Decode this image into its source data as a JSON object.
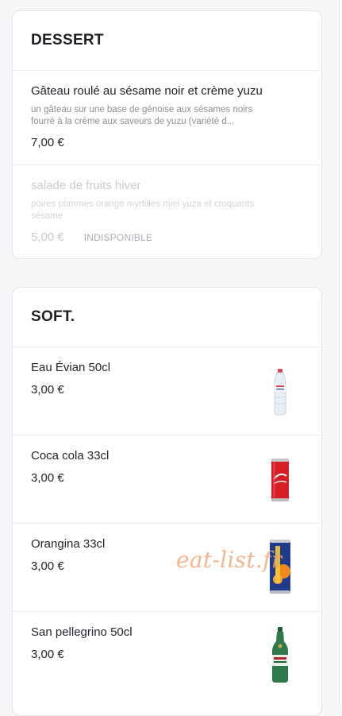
{
  "dessert": {
    "title": "DESSERT",
    "items": [
      {
        "name": "Gâteau roulé au sésame noir et crème yuzu",
        "description_line1": "un gâteau sur une base de génoise aux sésames noirs",
        "description_line2": "fourré à la crème aux saveurs de yuzu (variété d...",
        "price": "7,00 €",
        "available": true
      },
      {
        "name": "salade de fruits hiver",
        "description_line1": "poires pommes orange myrtilles miel yuza et croquants",
        "description_line2": "sésame",
        "price": "5,00 €",
        "badge": "INDISPONIBLE",
        "available": false
      }
    ]
  },
  "soft": {
    "title": "SOFT.",
    "items": [
      {
        "name": "Eau Évian 50cl",
        "price": "3,00 €",
        "image_icon": "evian-bottle-icon"
      },
      {
        "name": "Coca cola 33cl",
        "price": "3,00 €",
        "image_icon": "coca-cola-can-icon"
      },
      {
        "name": "Orangina 33cl",
        "price": "3,00 €",
        "image_icon": "orangina-can-icon"
      },
      {
        "name": "San pellegrino 50cl",
        "price": "3,00 €",
        "image_icon": "san-pellegrino-bottle-icon"
      }
    ]
  },
  "watermark": "eat-list.fr",
  "colors": {
    "background": "#f6f7f9",
    "card": "#ffffff",
    "text": "#1f2328",
    "muted": "#8b8f96",
    "watermark": "#f5a46f"
  }
}
